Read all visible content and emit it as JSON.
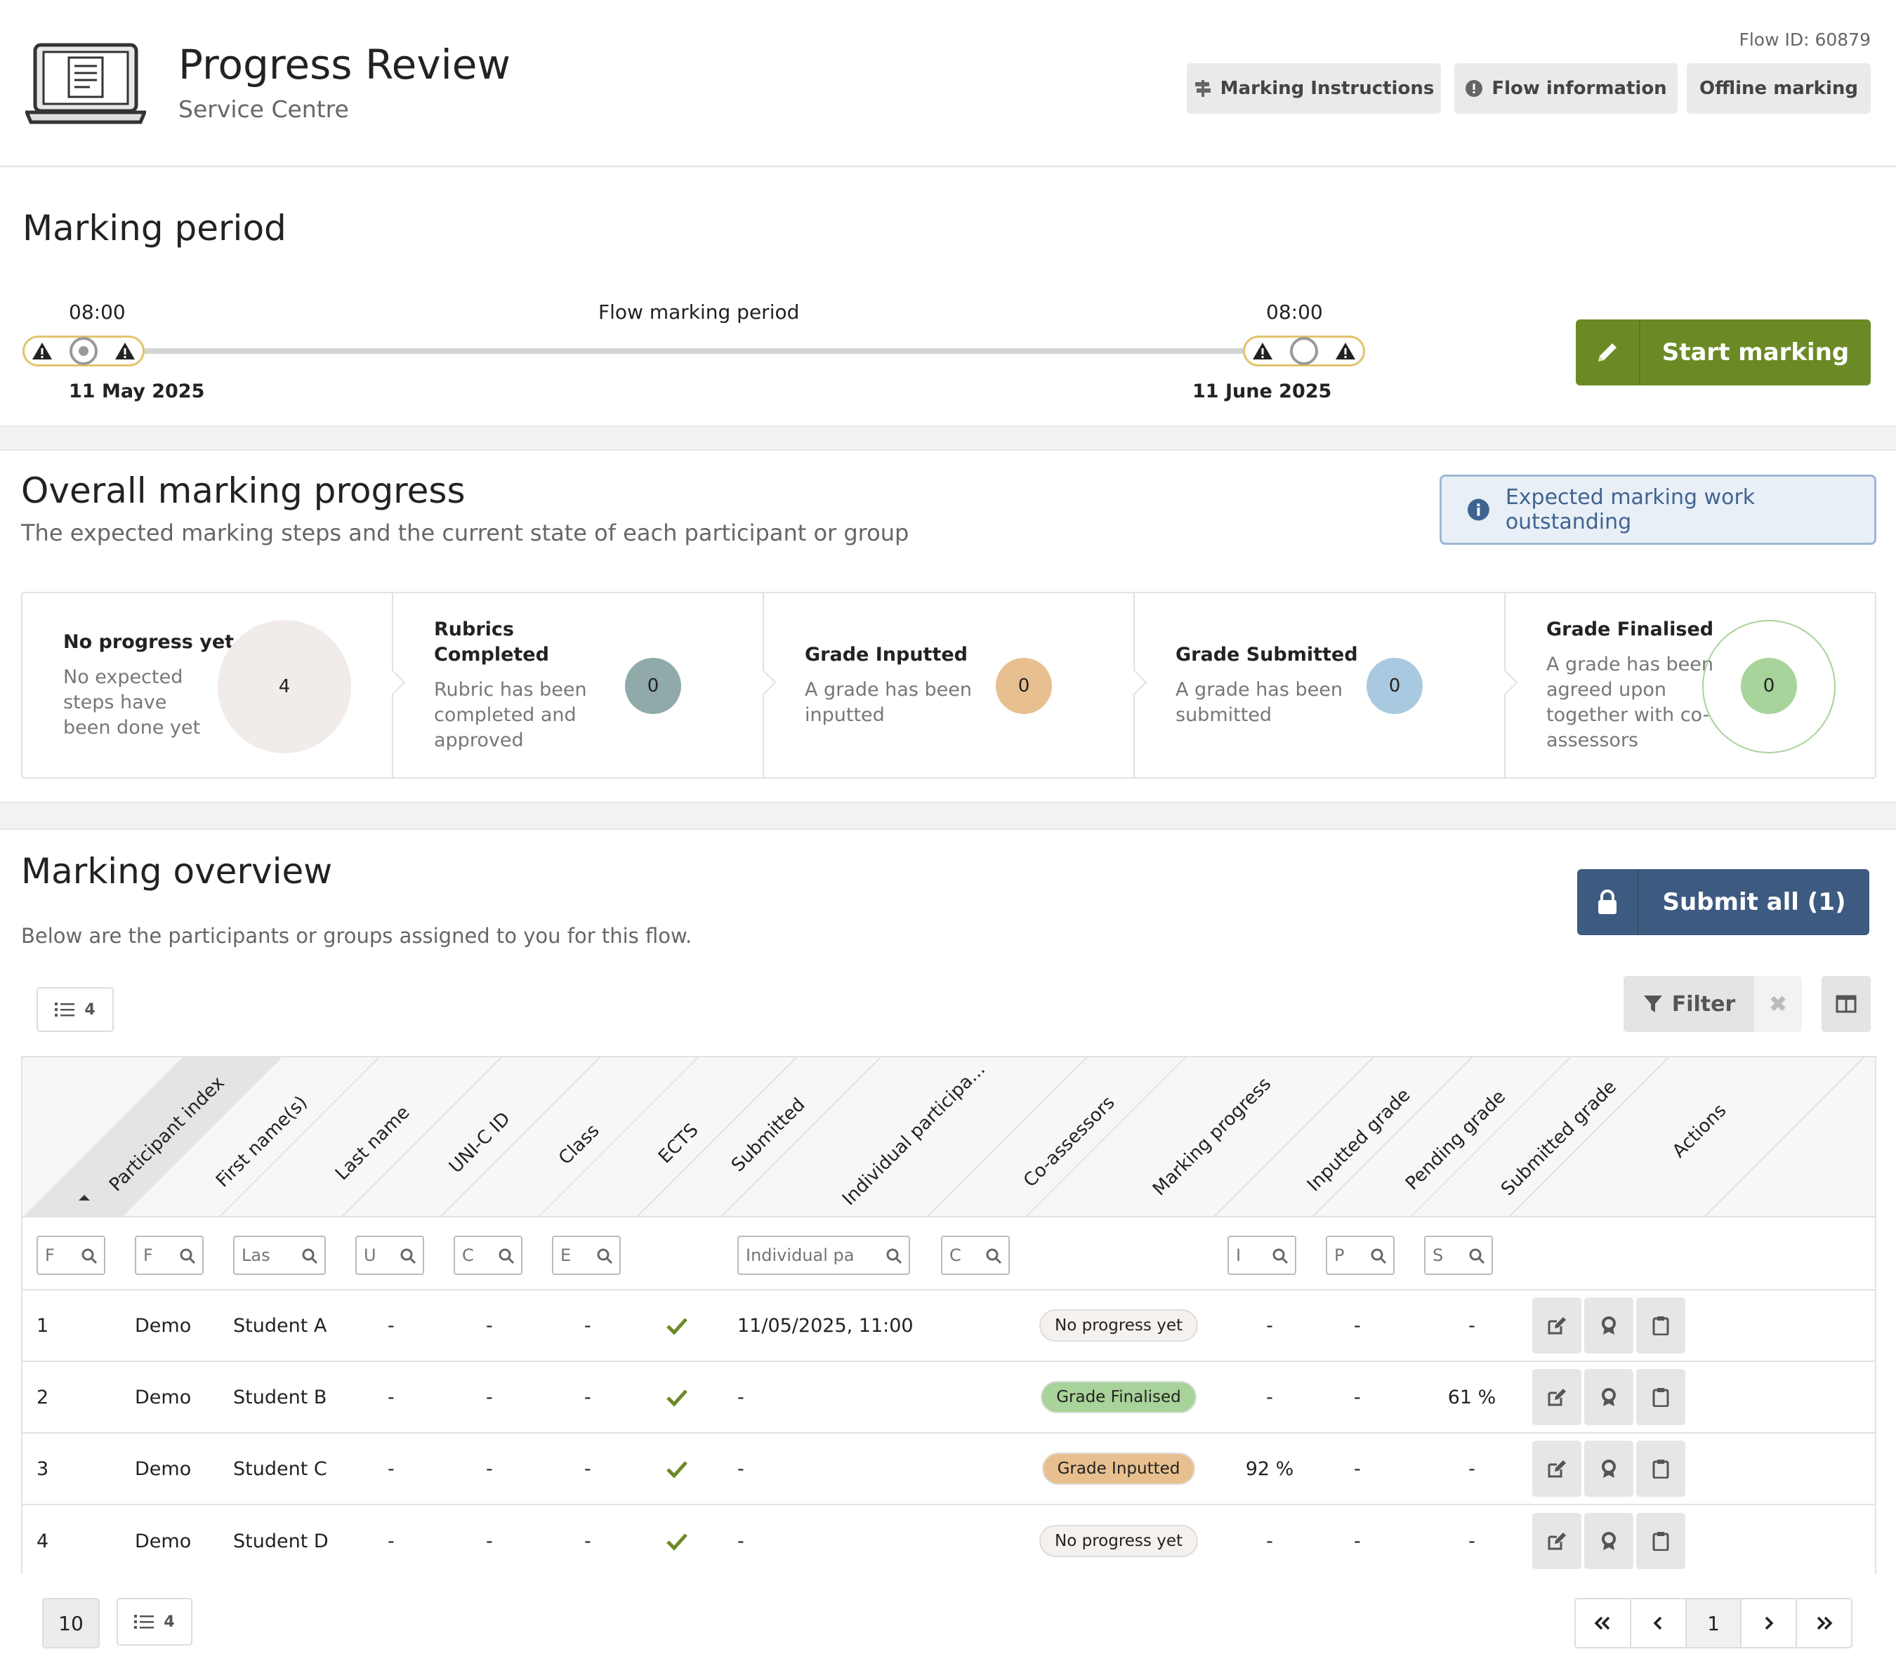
{
  "header": {
    "title": "Progress Review",
    "subtitle": "Service Centre",
    "flow_id": "Flow ID: 60879",
    "buttons": {
      "marking_instructions": "Marking Instructions",
      "flow_information": "Flow information",
      "offline_marking": "Offline marking"
    }
  },
  "marking_period": {
    "heading": "Marking period",
    "label": "Flow marking period",
    "start_time": "08:00",
    "start_date": "11 May 2025",
    "end_time": "08:00",
    "end_date": "11 June 2025",
    "start_button": "Start marking"
  },
  "progress": {
    "heading": "Overall marking progress",
    "description": "The expected marking steps and the current state of each participant or group",
    "info": "Expected marking work outstanding",
    "cards": [
      {
        "title": "No progress yet",
        "desc": "No expected steps have been done yet",
        "count": "4",
        "color": "#f1ece9"
      },
      {
        "title": "Rubrics Completed",
        "desc": "Rubric has been completed and approved",
        "count": "0",
        "color": "#8faaa8"
      },
      {
        "title": "Grade Inputted",
        "desc": "A grade has been inputted",
        "count": "0",
        "color": "#e8c08f"
      },
      {
        "title": "Grade Submitted",
        "desc": "A grade has been submitted",
        "count": "0",
        "color": "#a9c9e0"
      },
      {
        "title": "Grade Finalised",
        "desc": "A grade has been agreed upon together with co-assessors",
        "count": "0",
        "color": "#a8d39a"
      }
    ]
  },
  "overview": {
    "heading": "Marking overview",
    "description": "Below are the participants or groups assigned to you for this flow.",
    "submit_all": "Submit all (1)",
    "row_count": "4",
    "filter_label": "Filter",
    "columns": [
      "Participant index",
      "First name(s)",
      "Last name",
      "UNI-C ID",
      "Class",
      "ECTS",
      "Submitted",
      "Individual participa...",
      "Co-assessors",
      "Marking progress",
      "Inputted grade",
      "Pending grade",
      "Submitted grade",
      "Actions"
    ],
    "filter_placeholders": {
      "index": "F",
      "first": "F",
      "last": "Las",
      "uni": "U",
      "class": "C",
      "ects": "E",
      "individual": "Individual pa",
      "coassessors": "C",
      "inputted": "I",
      "pending": "P",
      "submitted": "S"
    },
    "rows": [
      {
        "index": "1",
        "first": "Demo",
        "last": "Student A",
        "uni": "-",
        "class": "-",
        "ects": "-",
        "submitted": "11/05/2025, 11:00",
        "progress": "No progress yet",
        "inputted": "-",
        "pending": "-",
        "submitted_grade": "-"
      },
      {
        "index": "2",
        "first": "Demo",
        "last": "Student B",
        "uni": "-",
        "class": "-",
        "ects": "-",
        "submitted": "-",
        "progress": "Grade Finalised",
        "inputted": "-",
        "pending": "-",
        "submitted_grade": "61 %"
      },
      {
        "index": "3",
        "first": "Demo",
        "last": "Student C",
        "uni": "-",
        "class": "-",
        "ects": "-",
        "submitted": "-",
        "progress": "Grade Inputted",
        "inputted": "92 %",
        "pending": "-",
        "submitted_grade": "-"
      },
      {
        "index": "4",
        "first": "Demo",
        "last": "Student D",
        "uni": "-",
        "class": "-",
        "ects": "-",
        "submitted": "-",
        "progress": "No progress yet",
        "inputted": "-",
        "pending": "-",
        "submitted_grade": "-"
      }
    ],
    "pagination": {
      "per_page": "10",
      "total": "4",
      "current_page": "1"
    }
  },
  "colors": {
    "start_button": "#6b8a26",
    "submit_button": "#3d5a80",
    "badge_no_progress": "#f5f1ee",
    "badge_finalised": "#a8d39a",
    "badge_inputted": "#e8c08f",
    "check": "#6b8a26"
  }
}
